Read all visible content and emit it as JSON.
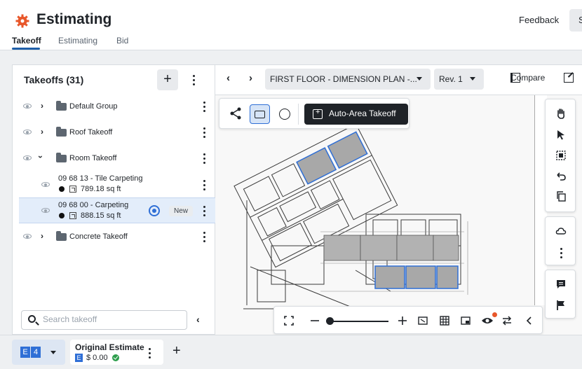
{
  "header": {
    "title": "Estimating",
    "feedback_label": "Feedback",
    "partial_button": "S",
    "tabs": [
      {
        "label": "Takeoff"
      },
      {
        "label": "Estimating"
      },
      {
        "label": "Bid"
      }
    ]
  },
  "takeoffs": {
    "title": "Takeoffs (31)",
    "groups": [
      {
        "label": "Default Group"
      },
      {
        "label": "Roof Takeoff"
      },
      {
        "label": "Room Takeoff"
      },
      {
        "label": "Concrete Takeoff"
      }
    ],
    "items": [
      {
        "name": "09 68 13 - Tile Carpeting",
        "qty": "789.18 sq ft"
      },
      {
        "name": "09 68 00 - Carpeting",
        "qty": "888.15 sq ft",
        "badge": "New"
      }
    ],
    "search_placeholder": "Search takeoff"
  },
  "viewer": {
    "sheet": "FIRST FLOOR - DIMENSION PLAN -...",
    "revision": "Rev. 1",
    "compare_label": "Compare",
    "auto_area_label": "Auto-Area Takeoff"
  },
  "estimate_bar": {
    "e_badge": "E",
    "count": "4",
    "name": "Original Estimate",
    "e_small": "E",
    "amount": "$ 0.00"
  },
  "icons": {
    "brand": "gear-icon",
    "accent_color": "#e8572a",
    "selection_color": "#2f6fd6"
  }
}
